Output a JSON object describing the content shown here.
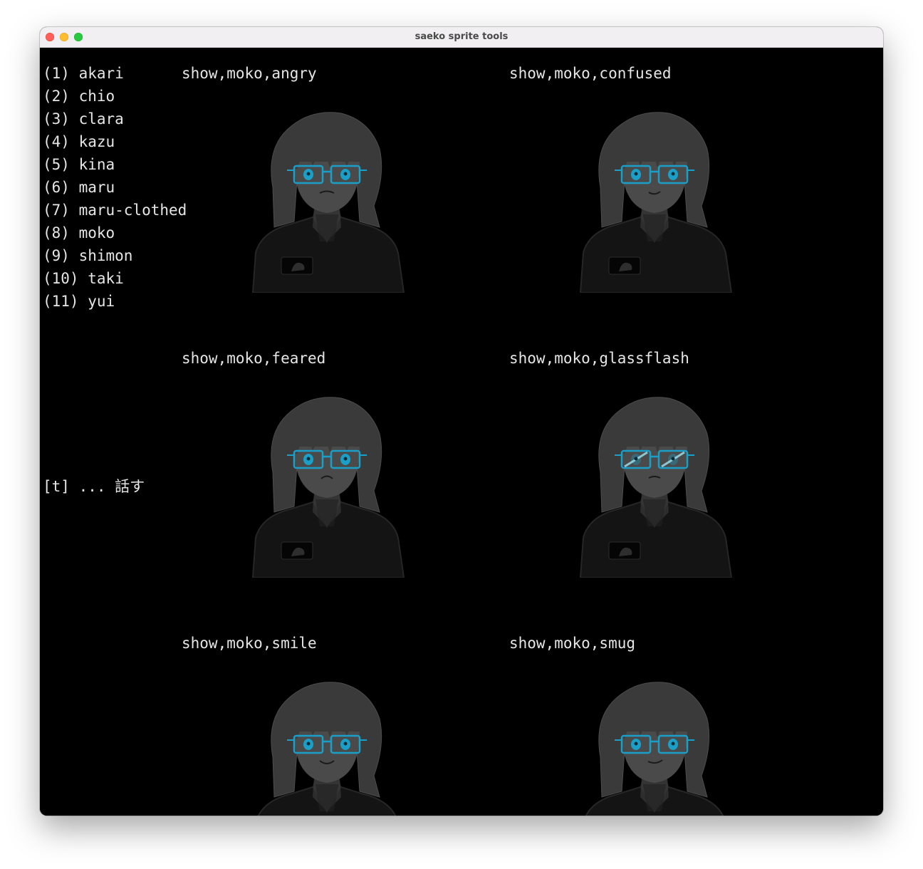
{
  "window": {
    "title": "saeko sprite tools"
  },
  "menu": {
    "items": [
      {
        "label": "(1) akari"
      },
      {
        "label": "(2) chio"
      },
      {
        "label": "(3) clara"
      },
      {
        "label": "(4) kazu"
      },
      {
        "label": "(5) kina"
      },
      {
        "label": "(6) maru"
      },
      {
        "label": "(7) maru-clothed"
      },
      {
        "label": "(8) moko"
      },
      {
        "label": "(9) shimon"
      },
      {
        "label": "(10) taki"
      },
      {
        "label": "(11) yui"
      }
    ]
  },
  "hint": "[t] ... 話す",
  "sprites": [
    {
      "label": "show,moko,angry",
      "expression": "angry"
    },
    {
      "label": "show,moko,confused",
      "expression": "confused"
    },
    {
      "label": "show,moko,feared",
      "expression": "feared"
    },
    {
      "label": "show,moko,glassflash",
      "expression": "glassflash"
    },
    {
      "label": "show,moko,smile",
      "expression": "smile"
    },
    {
      "label": "show,moko,smug",
      "expression": "smug"
    }
  ],
  "colors": {
    "background": "#000000",
    "text": "#e6e6e6",
    "sprite_hair": "#3a3a3a",
    "sprite_skin": "#4a4a4a",
    "sprite_eyes": "#1aa0c8"
  }
}
